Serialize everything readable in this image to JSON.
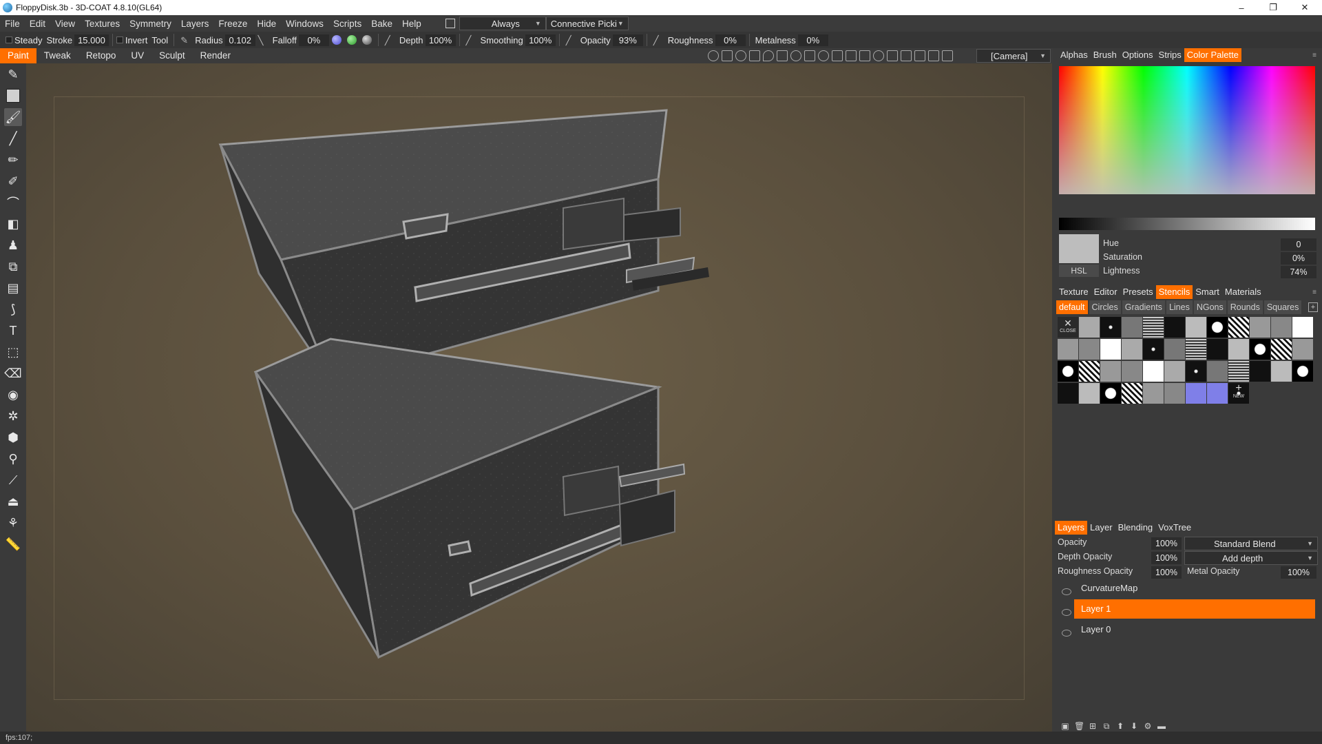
{
  "window": {
    "title": "FloppyDisk.3b - 3D-COAT 4.8.10(GL64)",
    "controls": [
      "–",
      "❐",
      "✕"
    ]
  },
  "menu": {
    "items": [
      "File",
      "Edit",
      "View",
      "Textures",
      "Symmetry",
      "Layers",
      "Freeze",
      "Hide",
      "Windows",
      "Scripts",
      "Bake",
      "Help"
    ],
    "dropdown1": "Always",
    "dropdown2": "Connective Picki"
  },
  "toolbar": {
    "steady_label": "Steady",
    "stroke_label": "Stroke",
    "stroke_value": "15.000",
    "invert_label": "Invert",
    "tool_label": "Tool",
    "radius_label": "Radius",
    "radius_value": "0.102",
    "falloff_label": "Falloff",
    "falloff_value": "0%",
    "depth_label": "Depth",
    "depth_value": "100%",
    "smoothing_label": "Smoothing",
    "smoothing_value": "100%",
    "opacity_label": "Opacity",
    "opacity_value": "93%",
    "roughness_label": "Roughness",
    "roughness_value": "0%",
    "metalness_label": "Metalness",
    "metalness_value": "0%"
  },
  "rooms": {
    "tabs": [
      "Paint",
      "Tweak",
      "Retopo",
      "UV",
      "Sculpt",
      "Render"
    ],
    "active": "Paint",
    "camera": "[Camera]"
  },
  "status": {
    "fps": "fps:107;"
  },
  "right_panel": {
    "top_tabs": [
      "Alphas",
      "Brush",
      "Options",
      "Strips",
      "Color Palette"
    ],
    "top_active": "Color Palette",
    "color": {
      "hue_label": "Hue",
      "hue_value": "0",
      "saturation_label": "Saturation",
      "saturation_value": "0%",
      "lightness_label": "Lightness",
      "lightness_value": "74%",
      "mode": "HSL",
      "swatch": "#bdbdbd"
    },
    "mid_tabs": [
      "Texture",
      "Editor",
      "Presets",
      "Stencils",
      "Smart",
      "Materials"
    ],
    "mid_active": "Stencils",
    "stencil_tabs": [
      "default",
      "Circles",
      "Gradients",
      "Lines",
      "NGons",
      "Rounds",
      "Squares"
    ],
    "stencil_active": "default",
    "stencil_close": "CLOSE",
    "stencil_new": "NEW",
    "layer_tabs": [
      "Layers",
      "Layer",
      "Blending",
      "VoxTree"
    ],
    "layer_tab_active": "Layers",
    "layer_props": {
      "opacity_label": "Opacity",
      "opacity_value": "100%",
      "blend_mode": "Standard Blend",
      "depth_label": "Depth Opacity",
      "depth_value": "100%",
      "depth_mode": "Add depth",
      "roughness_label": "Roughness Opacity",
      "roughness_value": "100%",
      "metal_label": "Metal Opacity",
      "metal_value": "100%"
    },
    "layers": [
      "CurvatureMap",
      "Layer 1",
      "Layer 0"
    ],
    "active_layer": "Layer 1"
  },
  "colors": {
    "accent": "#ff6f00",
    "panel": "#3a3a3a",
    "viewport": "#5e5240"
  }
}
